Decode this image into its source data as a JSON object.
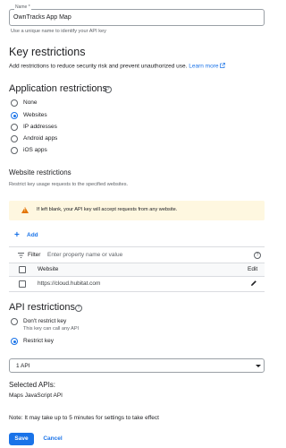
{
  "name_field": {
    "label": "Name *",
    "value": "OwnTracks App Map",
    "hint": "Use a unique name to identify your API key"
  },
  "key_restrictions": {
    "title": "Key restrictions",
    "description": "Add restrictions to reduce security risk and prevent unauthorized use.",
    "learn_more": "Learn more"
  },
  "app_restrictions": {
    "title": "Application restrictions",
    "options": [
      {
        "label": "None",
        "selected": false
      },
      {
        "label": "Websites",
        "selected": true
      },
      {
        "label": "IP addresses",
        "selected": false
      },
      {
        "label": "Android apps",
        "selected": false
      },
      {
        "label": "iOS apps",
        "selected": false
      }
    ]
  },
  "website_restrictions": {
    "title": "Website restrictions",
    "description": "Restrict key usage requests to the specified websites.",
    "warning": "If left blank, your API key will accept requests from any website.",
    "add_label": "Add",
    "filter_label": "Filter",
    "filter_placeholder": "Enter property name or value",
    "table": {
      "columns": [
        "Website",
        "Edit"
      ],
      "rows": [
        {
          "website": "https://cloud.hubitat.com"
        }
      ]
    }
  },
  "api_restrictions": {
    "title": "API restrictions",
    "options": [
      {
        "label": "Don't restrict key",
        "sublabel": "This key can call any API",
        "selected": false
      },
      {
        "label": "Restrict key",
        "selected": true
      }
    ],
    "select_value": "1 API",
    "selected_apis_title": "Selected APIs:",
    "selected_apis": [
      "Maps JavaScript API"
    ]
  },
  "note": "Note: It may take up to 5 minutes for settings to take effect",
  "buttons": {
    "save": "Save",
    "cancel": "Cancel"
  },
  "colors": {
    "accent": "#1a73e8",
    "warning_bg": "#fef7e0",
    "warning_icon": "#e37400"
  }
}
